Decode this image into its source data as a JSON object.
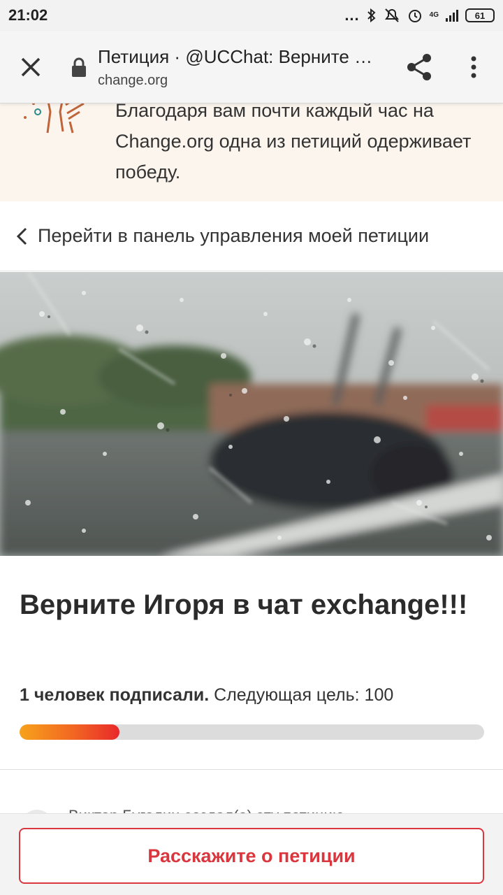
{
  "status_bar": {
    "time": "21:02",
    "dots": "...",
    "network": "4G",
    "battery": "61",
    "icons": [
      "bluetooth-icon",
      "mute-icon",
      "alarm-icon",
      "signal-icon",
      "battery-icon"
    ]
  },
  "toolbar": {
    "title": "Петиция · @UCChat: Верните Игоря в чат exchange!!!",
    "url": "change.org",
    "icons": [
      "close-icon",
      "lock-icon",
      "share-icon",
      "more-vert-icon"
    ]
  },
  "banner": {
    "text": "Благодаря вам почти каждый час на Change.org одна из петиций одерживает победу."
  },
  "back_link": {
    "label": "Перейти в панель управления моей петиции"
  },
  "petition": {
    "title": "Верните Игоря в чат exchange!!!",
    "signers_bold": "1 человек подписали.",
    "next_goal": "Следующая цель: 100",
    "progress": 0.215,
    "creator_text": "Виктор Бугалин создал(а) эту петицию"
  },
  "bottom": {
    "share_label": "Расскажите о петиции"
  },
  "colors": {
    "accent": "#d9363e",
    "progress_start": "#f7a21b",
    "progress_end": "#e8282b",
    "banner_bg": "#fbf5ee"
  }
}
